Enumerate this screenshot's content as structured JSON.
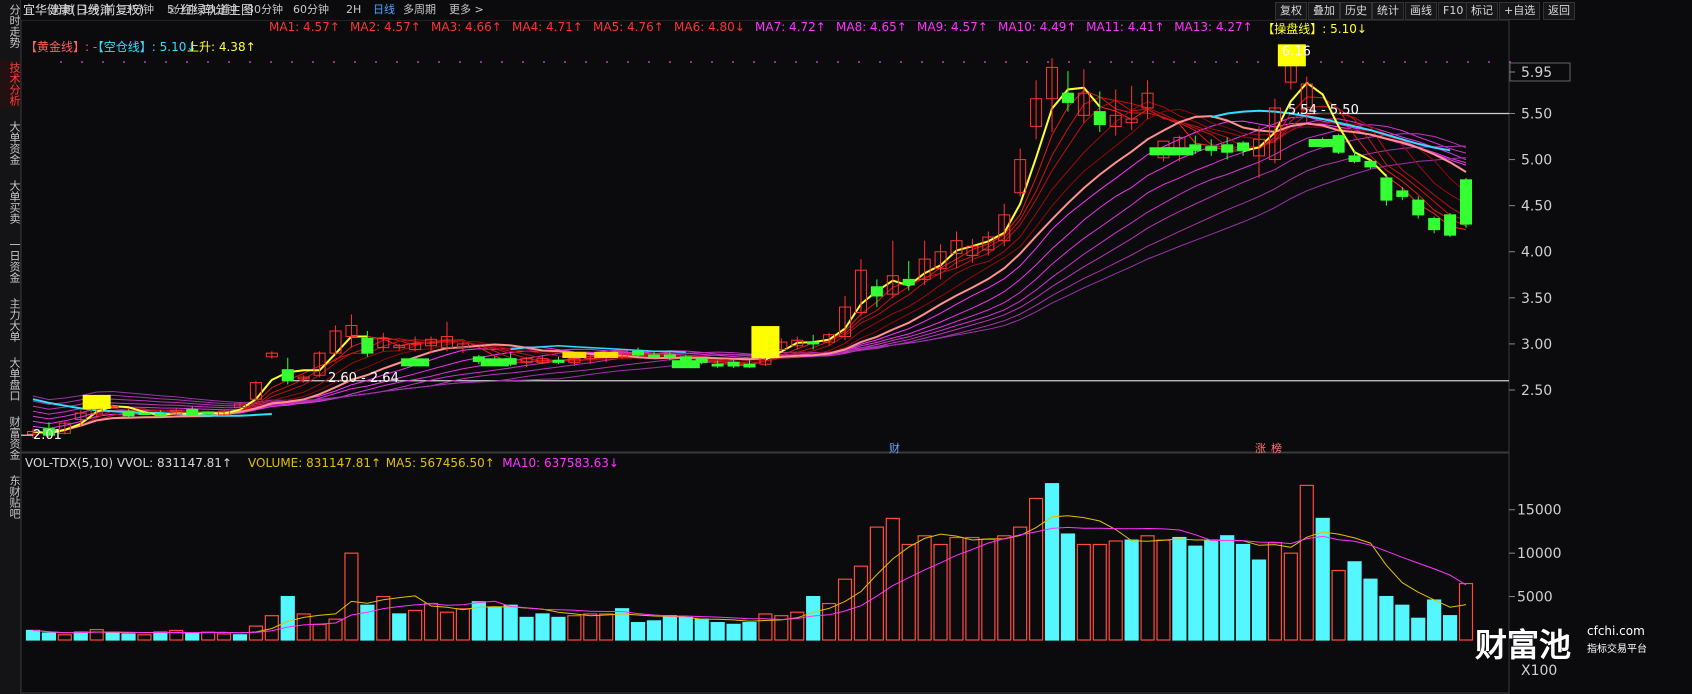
{
  "sidebar": {
    "tabs": [
      "分时走势",
      "技术分析",
      "大单资金",
      "大单买卖",
      "一日资金",
      "主力大单",
      "大单盘口",
      "财富资金",
      "东财贴吧"
    ],
    "active_index": 1
  },
  "header": {
    "stock_name": "宜华健康(日线,前复权)",
    "indicator_name": "红绿轨道主图",
    "timeframes": [
      "分时",
      "1分钟",
      "3分钟",
      "5分钟",
      "15分钟",
      "30分钟",
      "60分钟",
      "2H",
      "日线",
      "多周期",
      "更多 >"
    ],
    "active_timeframe_index": 8,
    "right_buttons": [
      "复权",
      "叠加",
      "历史",
      "统计",
      "画线",
      "F10",
      "标记",
      "+自选",
      "返回"
    ]
  },
  "main_legend": {
    "row1": [
      {
        "text": "MA1: 4.57↑",
        "color": "#ff3333"
      },
      {
        "text": "MA2: 4.57↑",
        "color": "#ff3333"
      },
      {
        "text": "MA3: 4.66↑",
        "color": "#ff3333"
      },
      {
        "text": "MA4: 4.71↑",
        "color": "#ff3333"
      },
      {
        "text": "MA5: 4.76↑",
        "color": "#ff3333"
      },
      {
        "text": "MA6: 4.80↓",
        "color": "#ff3333"
      },
      {
        "text": "MA7: 4.72↑",
        "color": "#ff33ff"
      },
      {
        "text": "MA8: 4.65↑",
        "color": "#ff33ff"
      },
      {
        "text": "MA9: 4.57↑",
        "color": "#ff33ff"
      },
      {
        "text": "MA10: 4.49↑",
        "color": "#ff33ff"
      },
      {
        "text": "MA11: 4.41↑",
        "color": "#ff33ff"
      },
      {
        "text": "MA13: 4.27↑",
        "color": "#ff33ff"
      },
      {
        "text": "【操盘线】: 5.10↓",
        "color": "#ffff33"
      }
    ],
    "row2": [
      {
        "text": "【黄金线】: -",
        "color": "#ff6060"
      },
      {
        "text": "【空仓线】: 5.10↓",
        "color": "#33ddff"
      },
      {
        "text": "上升: 4.38↑",
        "color": "#ffff33"
      }
    ]
  },
  "vol_legend": [
    {
      "text": "VOL-TDX(5,10) VVOL: 831147.81↑",
      "color": "#d8d8d8"
    },
    {
      "text": "VOLUME: 831147.81↑",
      "color": "#e0c000"
    },
    {
      "text": "MA5: 567456.50↑",
      "color": "#e0c000"
    },
    {
      "text": "MA10: 637583.63↓",
      "color": "#ff33ff"
    }
  ],
  "price_axis": [
    "5.95",
    "5.50",
    "5.00",
    "4.50",
    "4.00",
    "3.50",
    "3.00",
    "2.50"
  ],
  "volume_axis": [
    "15000",
    "10000",
    "5000",
    "X100"
  ],
  "annotations": {
    "high_label": "6.16",
    "resistance_label": "5.54 - 5.50",
    "support_label": "2.60 - 2.64",
    "low_label": "2.01",
    "event_finance": "财",
    "event_zhang": "涨",
    "event_bang": "榜"
  },
  "colors": {
    "up": "#ff3333",
    "down": "#33ff33",
    "vol_up": "#ff4b3b",
    "vol_down": "#54f7ff",
    "ma_yellow": "#ffff33",
    "ma_cyan": "#33ddff",
    "ma_pink": "#ff9090"
  },
  "watermark": {
    "title": "财富池",
    "site": "cfchi.com",
    "subtitle": "指标交易平台"
  },
  "chart_data": {
    "type": "candlestick",
    "y_range": [
      2.0,
      6.3
    ],
    "candles": [
      {
        "o": 2.02,
        "h": 2.08,
        "l": 1.98,
        "c": 2.05
      },
      {
        "o": 2.08,
        "h": 2.15,
        "l": 1.99,
        "c": 2.01
      },
      {
        "o": 2.03,
        "h": 2.16,
        "l": 2.02,
        "c": 2.14
      },
      {
        "o": 2.18,
        "h": 2.28,
        "l": 2.1,
        "c": 2.25
      },
      {
        "o": 2.24,
        "h": 2.42,
        "l": 2.2,
        "c": 2.4
      },
      {
        "o": 2.32,
        "h": 2.34,
        "l": 2.3,
        "c": 2.32
      },
      {
        "o": 2.27,
        "h": 2.29,
        "l": 2.2,
        "c": 2.22
      },
      {
        "o": 2.25,
        "h": 2.26,
        "l": 2.23,
        "c": 2.24
      },
      {
        "o": 2.24,
        "h": 2.28,
        "l": 2.2,
        "c": 2.22
      },
      {
        "o": 2.24,
        "h": 2.3,
        "l": 2.22,
        "c": 2.28
      },
      {
        "o": 2.29,
        "h": 2.32,
        "l": 2.22,
        "c": 2.23
      },
      {
        "o": 2.26,
        "h": 2.27,
        "l": 2.21,
        "c": 2.24
      },
      {
        "o": 2.23,
        "h": 2.28,
        "l": 2.22,
        "c": 2.27
      },
      {
        "o": 2.31,
        "h": 2.36,
        "l": 2.29,
        "c": 2.35
      },
      {
        "o": 2.4,
        "h": 2.6,
        "l": 2.38,
        "c": 2.58
      },
      {
        "o": 2.86,
        "h": 2.92,
        "l": 2.84,
        "c": 2.9
      },
      {
        "o": 2.72,
        "h": 2.85,
        "l": 2.56,
        "c": 2.6
      },
      {
        "o": 2.62,
        "h": 2.66,
        "l": 2.58,
        "c": 2.64
      },
      {
        "o": 2.66,
        "h": 2.92,
        "l": 2.64,
        "c": 2.9
      },
      {
        "o": 2.9,
        "h": 3.2,
        "l": 2.88,
        "c": 3.14
      },
      {
        "o": 3.08,
        "h": 3.32,
        "l": 2.96,
        "c": 3.2
      },
      {
        "o": 3.06,
        "h": 3.14,
        "l": 2.86,
        "c": 2.9
      },
      {
        "o": 2.96,
        "h": 3.12,
        "l": 2.92,
        "c": 3.06
      },
      {
        "o": 2.96,
        "h": 3.0,
        "l": 2.93,
        "c": 2.98
      },
      {
        "o": 2.94,
        "h": 3.08,
        "l": 2.92,
        "c": 3.0
      },
      {
        "o": 2.98,
        "h": 3.08,
        "l": 2.9,
        "c": 3.05
      },
      {
        "o": 2.96,
        "h": 3.24,
        "l": 2.92,
        "c": 3.08
      },
      {
        "o": 2.96,
        "h": 3.02,
        "l": 2.9,
        "c": 3.0
      },
      {
        "o": 2.86,
        "h": 2.88,
        "l": 2.78,
        "c": 2.81
      },
      {
        "o": 2.82,
        "h": 2.86,
        "l": 2.78,
        "c": 2.8
      },
      {
        "o": 2.84,
        "h": 2.9,
        "l": 2.76,
        "c": 2.78
      },
      {
        "o": 2.8,
        "h": 2.86,
        "l": 2.75,
        "c": 2.84
      },
      {
        "o": 2.8,
        "h": 2.88,
        "l": 2.78,
        "c": 2.84
      },
      {
        "o": 2.82,
        "h": 2.86,
        "l": 2.78,
        "c": 2.8
      },
      {
        "o": 2.8,
        "h": 2.9,
        "l": 2.76,
        "c": 2.84
      },
      {
        "o": 2.84,
        "h": 2.88,
        "l": 2.78,
        "c": 2.86
      },
      {
        "o": 2.88,
        "h": 2.92,
        "l": 2.8,
        "c": 2.9
      },
      {
        "o": 2.86,
        "h": 2.94,
        "l": 2.84,
        "c": 2.92
      },
      {
        "o": 2.92,
        "h": 2.96,
        "l": 2.86,
        "c": 2.88
      },
      {
        "o": 2.88,
        "h": 2.92,
        "l": 2.84,
        "c": 2.86
      },
      {
        "o": 2.88,
        "h": 2.92,
        "l": 2.82,
        "c": 2.86
      },
      {
        "o": 2.86,
        "h": 2.88,
        "l": 2.8,
        "c": 2.82
      },
      {
        "o": 2.84,
        "h": 2.86,
        "l": 2.78,
        "c": 2.8
      },
      {
        "o": 2.78,
        "h": 2.82,
        "l": 2.74,
        "c": 2.76
      },
      {
        "o": 2.8,
        "h": 2.82,
        "l": 2.74,
        "c": 2.76
      },
      {
        "o": 2.78,
        "h": 2.82,
        "l": 2.74,
        "c": 2.75
      },
      {
        "o": 2.78,
        "h": 3.06,
        "l": 2.76,
        "c": 2.98
      },
      {
        "o": 2.94,
        "h": 3.06,
        "l": 2.92,
        "c": 3.02
      },
      {
        "o": 2.98,
        "h": 3.08,
        "l": 2.94,
        "c": 3.04
      },
      {
        "o": 3.02,
        "h": 3.1,
        "l": 2.94,
        "c": 3.0
      },
      {
        "o": 3.02,
        "h": 3.12,
        "l": 2.98,
        "c": 3.1
      },
      {
        "o": 3.08,
        "h": 3.52,
        "l": 3.04,
        "c": 3.4
      },
      {
        "o": 3.34,
        "h": 3.92,
        "l": 3.3,
        "c": 3.8
      },
      {
        "o": 3.62,
        "h": 3.7,
        "l": 3.4,
        "c": 3.52
      },
      {
        "o": 3.54,
        "h": 4.12,
        "l": 3.5,
        "c": 3.74
      },
      {
        "o": 3.7,
        "h": 3.9,
        "l": 3.58,
        "c": 3.64
      },
      {
        "o": 3.7,
        "h": 4.12,
        "l": 3.64,
        "c": 3.92
      },
      {
        "o": 3.82,
        "h": 4.08,
        "l": 3.7,
        "c": 4.0
      },
      {
        "o": 3.98,
        "h": 4.22,
        "l": 3.82,
        "c": 4.12
      },
      {
        "o": 3.96,
        "h": 4.14,
        "l": 3.88,
        "c": 4.06
      },
      {
        "o": 4.02,
        "h": 4.22,
        "l": 3.96,
        "c": 4.16
      },
      {
        "o": 4.12,
        "h": 4.52,
        "l": 4.06,
        "c": 4.4
      },
      {
        "o": 4.64,
        "h": 5.12,
        "l": 4.6,
        "c": 5.0
      },
      {
        "o": 5.36,
        "h": 5.86,
        "l": 5.22,
        "c": 5.66
      },
      {
        "o": 5.66,
        "h": 6.1,
        "l": 5.3,
        "c": 6.0
      },
      {
        "o": 5.72,
        "h": 5.96,
        "l": 5.52,
        "c": 5.62
      },
      {
        "o": 5.48,
        "h": 5.98,
        "l": 5.4,
        "c": 5.72
      },
      {
        "o": 5.52,
        "h": 5.74,
        "l": 5.3,
        "c": 5.38
      },
      {
        "o": 5.36,
        "h": 5.76,
        "l": 5.26,
        "c": 5.48
      },
      {
        "o": 5.4,
        "h": 5.8,
        "l": 5.32,
        "c": 5.44
      },
      {
        "o": 5.56,
        "h": 5.86,
        "l": 5.44,
        "c": 5.72
      },
      {
        "o": 5.02,
        "h": 5.14,
        "l": 4.98,
        "c": 5.2
      },
      {
        "o": 5.06,
        "h": 5.26,
        "l": 4.98,
        "c": 5.24
      },
      {
        "o": 5.16,
        "h": 5.26,
        "l": 5.06,
        "c": 5.1
      },
      {
        "o": 5.14,
        "h": 5.22,
        "l": 5.04,
        "c": 5.1
      },
      {
        "o": 5.16,
        "h": 5.24,
        "l": 5.0,
        "c": 5.08
      },
      {
        "o": 5.18,
        "h": 5.2,
        "l": 5.04,
        "c": 5.1
      },
      {
        "o": 5.04,
        "h": 5.36,
        "l": 4.8,
        "c": 5.22
      },
      {
        "o": 5.0,
        "h": 5.66,
        "l": 4.96,
        "c": 5.56
      },
      {
        "o": 5.84,
        "h": 6.16,
        "l": 5.76,
        "c": 6.12
      },
      {
        "o": 5.54,
        "h": 5.9,
        "l": 5.4,
        "c": 5.82
      },
      {
        "o": 5.2,
        "h": 5.24,
        "l": 5.14,
        "c": 5.18
      },
      {
        "o": 5.26,
        "h": 5.28,
        "l": 5.06,
        "c": 5.08
      },
      {
        "o": 5.04,
        "h": 5.1,
        "l": 4.96,
        "c": 4.98
      },
      {
        "o": 4.98,
        "h": 5.0,
        "l": 4.9,
        "c": 4.92
      },
      {
        "o": 4.8,
        "h": 4.84,
        "l": 4.5,
        "c": 4.56
      },
      {
        "o": 4.66,
        "h": 4.7,
        "l": 4.56,
        "c": 4.6
      },
      {
        "o": 4.56,
        "h": 4.6,
        "l": 4.36,
        "c": 4.4
      },
      {
        "o": 4.36,
        "h": 4.38,
        "l": 4.2,
        "c": 4.24
      },
      {
        "o": 4.4,
        "h": 4.42,
        "l": 4.16,
        "c": 4.18
      },
      {
        "o": 4.78,
        "h": 4.8,
        "l": 4.26,
        "c": 4.3
      }
    ],
    "volume": [
      11,
      8,
      6,
      9,
      12,
      9,
      7,
      6,
      9,
      11,
      8,
      9,
      7,
      6,
      16,
      28,
      50,
      30,
      18,
      24,
      100,
      40,
      50,
      30,
      34,
      42,
      32,
      36,
      44,
      38,
      40,
      26,
      30,
      26,
      28,
      30,
      30,
      36,
      20,
      22,
      28,
      26,
      24,
      20,
      18,
      20,
      30,
      28,
      32,
      50,
      42,
      70,
      85,
      130,
      140,
      110,
      120,
      110,
      118,
      118,
      116,
      120,
      130,
      163,
      180,
      122,
      110,
      110,
      114,
      115,
      120,
      115,
      118,
      108,
      115,
      120,
      110,
      92,
      112,
      100,
      178,
      140,
      80,
      90,
      70,
      50,
      40,
      25,
      46,
      28,
      65
    ],
    "volume_up": [
      false,
      false,
      true,
      false,
      true,
      false,
      false,
      true,
      false,
      true,
      false,
      true,
      true,
      false,
      true,
      true,
      false,
      true,
      true,
      true,
      true,
      false,
      true,
      false,
      true,
      true,
      true,
      true,
      false,
      false,
      false,
      false,
      false,
      false,
      true,
      true,
      true,
      false,
      false,
      false,
      false,
      false,
      false,
      false,
      false,
      false,
      true,
      true,
      true,
      false,
      true,
      true,
      true,
      true,
      true,
      true,
      true,
      true,
      true,
      true,
      true,
      true,
      true,
      true,
      false,
      false,
      true,
      true,
      true,
      false,
      true,
      true,
      false,
      false,
      false,
      false,
      false,
      false,
      true,
      true,
      true,
      false,
      true,
      false,
      false,
      false,
      false,
      false,
      false,
      false,
      true
    ]
  }
}
